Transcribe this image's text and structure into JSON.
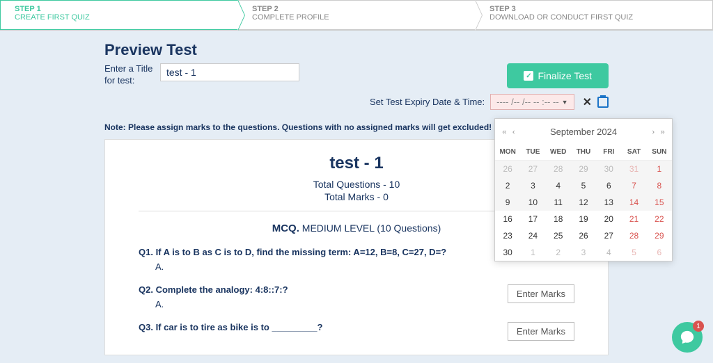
{
  "stepper": [
    {
      "num": "STEP 1",
      "title": "CREATE FIRST QUIZ",
      "active": true
    },
    {
      "num": "STEP 2",
      "title": "COMPLETE PROFILE",
      "active": false
    },
    {
      "num": "STEP 3",
      "title": "DOWNLOAD OR CONDUCT FIRST QUIZ",
      "active": false
    }
  ],
  "preview_heading": "Preview Test",
  "title_label": "Enter a Title for test:",
  "title_value": "test - 1",
  "finalize_label": "Finalize Test",
  "expiry_label": "Set Test Expiry Date & Time:",
  "expiry_placeholder": "---- /-- /--  -- :-- --",
  "note": "Note: Please assign marks to the questions. Questions with no assigned marks will get excluded!",
  "test": {
    "title": "test - 1",
    "total_questions_label": "Total Questions - 10",
    "total_marks_label": "Total Marks - 0",
    "section_type": "MCQ.",
    "section_meta": "MEDIUM LEVEL (10 Questions)",
    "enter_marks_label": "Enter Marks",
    "questions": [
      {
        "q": "Q1. If A is to B as C is to D, find the missing term: A=12, B=8, C=27, D=?",
        "opt": "A."
      },
      {
        "q": "Q2. Complete the analogy: 4:8::7:?",
        "opt": "A."
      },
      {
        "q": "Q3. If car is to tire as bike is to _________?",
        "opt": ""
      }
    ]
  },
  "calendar": {
    "month_label": "September 2024",
    "nav_first": "«",
    "nav_prev": "‹",
    "nav_next": "›",
    "nav_last": "»",
    "dow": [
      "MON",
      "TUE",
      "WED",
      "THU",
      "FRI",
      "SAT",
      "SUN"
    ]
  },
  "chat_badge": "1"
}
